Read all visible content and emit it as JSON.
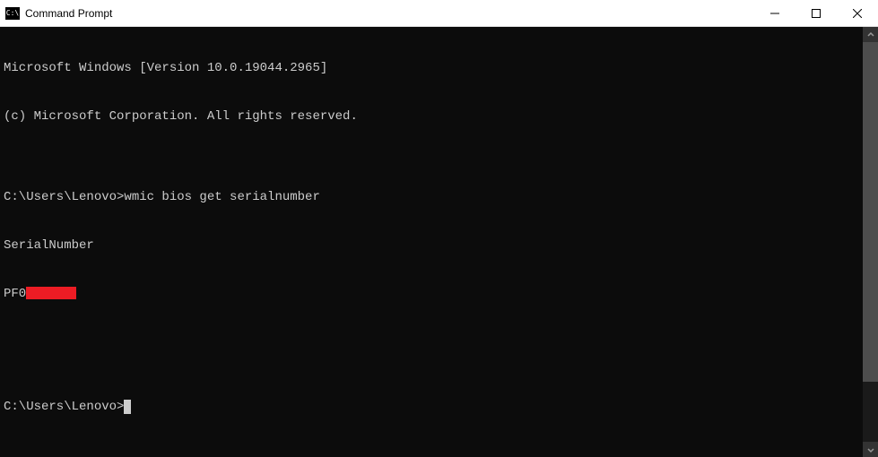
{
  "window": {
    "title": "Command Prompt",
    "icon_label": "cmd-icon"
  },
  "terminal": {
    "line1": "Microsoft Windows [Version 10.0.19044.2965]",
    "line2": "(c) Microsoft Corporation. All rights reserved.",
    "blank1": "",
    "prompt1_path": "C:\\Users\\Lenovo>",
    "prompt1_command": "wmic bios get serialnumber",
    "output_header": "SerialNumber",
    "output_value_prefix": "PF0",
    "blank2": "",
    "blank3": "",
    "prompt2_path": "C:\\Users\\Lenovo>"
  }
}
